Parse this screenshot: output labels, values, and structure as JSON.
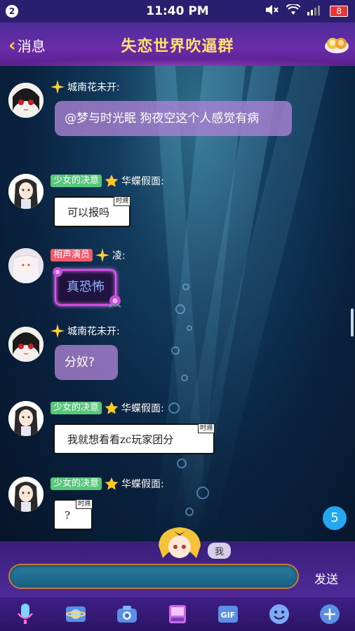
{
  "status_bar": {
    "notification_count": "2",
    "time": "11:40 PM",
    "battery": "8",
    "icons": [
      "mute-icon",
      "wifi-icon",
      "signal-icon"
    ]
  },
  "header": {
    "back_label": "消息",
    "title": "失恋世界吹逼群",
    "group_icon": "group-members-icon"
  },
  "messages": [
    {
      "sender": "城南花未开:",
      "badge": "",
      "text": "@梦与时光眠 狗夜空这个人感觉有病",
      "style": "purple"
    },
    {
      "sender": "华蝶假面:",
      "badge": "少女的决意",
      "text": "可以报吗",
      "style": "note",
      "note_tag": "时溯"
    },
    {
      "sender": "凌:",
      "badge": "相声演员",
      "text": "真恐怖",
      "style": "neon"
    },
    {
      "sender": "城南花未开:",
      "badge": "",
      "text": "分奴?",
      "style": "purple"
    },
    {
      "sender": "华蝶假面:",
      "badge": "少女的决意",
      "text": "我就想看看zc玩家团分",
      "style": "note",
      "note_tag": "时溯"
    },
    {
      "sender": "华蝶假面:",
      "badge": "少女的决意",
      "text": "?",
      "style": "note",
      "note_tag": "时溯"
    }
  ],
  "unread_count": "5",
  "composer": {
    "me_label": "我",
    "input_value": "",
    "send_label": "发送"
  },
  "toolbar": {
    "items": [
      "microphone-icon",
      "image-icon",
      "camera-icon",
      "sticker-icon",
      "gif-icon",
      "emoji-icon",
      "plus-icon"
    ],
    "gif_label": "GIF"
  },
  "colors": {
    "title": "#ffe16b",
    "header_bg": "#5b2ca0",
    "badge_green": "#57c87b",
    "badge_pink": "#f05a6a",
    "unread": "#25a7f0"
  }
}
